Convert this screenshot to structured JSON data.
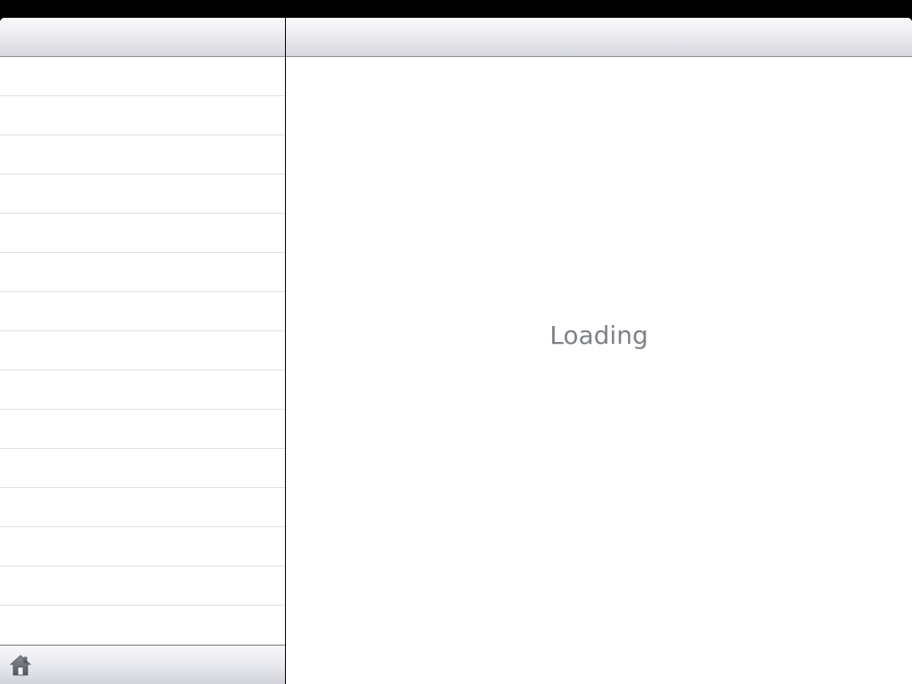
{
  "master": {
    "list": {
      "rows": [
        "",
        "",
        "",
        "",
        "",
        "",
        "",
        "",
        "",
        "",
        "",
        "",
        "",
        "",
        ""
      ]
    },
    "toolbar": {
      "home_icon": "home-icon"
    }
  },
  "detail": {
    "loading_text": "Loading"
  },
  "colors": {
    "status_bar": "#000000",
    "loading_text": "#7e8188",
    "row_separator": "#e0e0e0",
    "bar_border": "#8b8c95"
  }
}
